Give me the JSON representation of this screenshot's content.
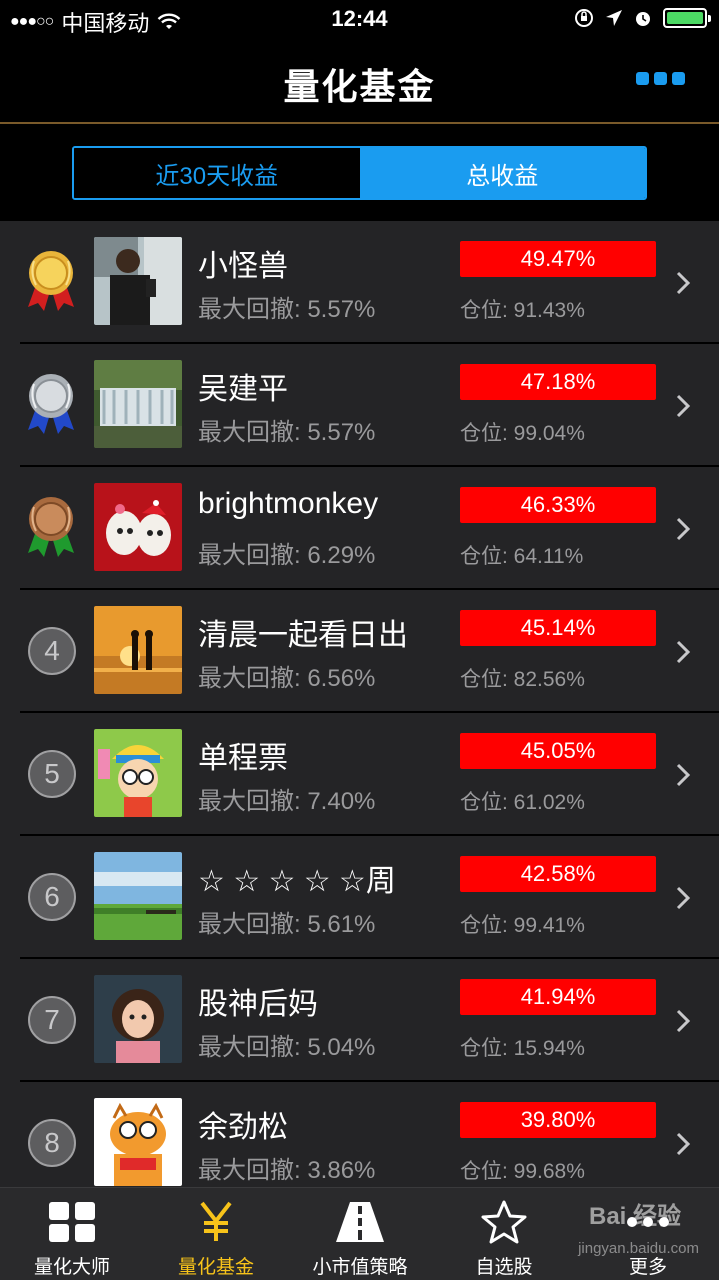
{
  "status_bar": {
    "carrier": "中国移动",
    "signal": "●●●○○",
    "time": "12:44"
  },
  "header": {
    "title": "量化基金"
  },
  "segment": {
    "tab_30d": "近30天收益",
    "tab_total": "总收益",
    "active": "总收益"
  },
  "colors": {
    "accent": "#1a9cf0",
    "return_bg": "#ff0000",
    "tab_active": "#f7c31a",
    "list_bg": "#242426"
  },
  "rows": [
    {
      "rank": "1",
      "badge": "gold-medal",
      "name": "小怪兽",
      "drawdown": "最大回撤: 5.57%",
      "return": "49.47%",
      "position": "仓位: 91.43%",
      "avatar": "person-selfie"
    },
    {
      "rank": "2",
      "badge": "silver-medal",
      "name": "吴建平",
      "drawdown": "最大回撤: 5.57%",
      "return": "47.18%",
      "position": "仓位: 99.04%",
      "avatar": "waterfall"
    },
    {
      "rank": "3",
      "badge": "bronze-medal",
      "name": "brightmonkey",
      "drawdown": "最大回撤: 6.29%",
      "return": "46.33%",
      "position": "仓位: 64.11%",
      "avatar": "eggs-couple"
    },
    {
      "rank": "4",
      "badge": "number",
      "name": "清晨一起看日出",
      "drawdown": "最大回撤: 6.56%",
      "return": "45.14%",
      "position": "仓位: 82.56%",
      "avatar": "sunset-couple"
    },
    {
      "rank": "5",
      "badge": "number",
      "name": "单程票",
      "drawdown": "最大回撤: 7.40%",
      "return": "45.05%",
      "position": "仓位: 61.02%",
      "avatar": "cartoon-arale"
    },
    {
      "rank": "6",
      "badge": "number",
      "name": "☆ ☆ ☆ ☆ ☆周",
      "drawdown": "最大回撤: 5.61%",
      "return": "42.58%",
      "position": "仓位: 99.41%",
      "avatar": "grassland"
    },
    {
      "rank": "7",
      "badge": "number",
      "name": "股神后妈",
      "drawdown": "最大回撤: 5.04%",
      "return": "41.94%",
      "position": "仓位: 15.94%",
      "avatar": "little-girl"
    },
    {
      "rank": "8",
      "badge": "number",
      "name": "余劲松",
      "drawdown": "最大回撤: 3.86%",
      "return": "39.80%",
      "position": "仓位: 99.68%",
      "avatar": "garfield"
    }
  ],
  "tabbar": {
    "items": [
      {
        "label": "量化大师",
        "icon": "grid-icon"
      },
      {
        "label": "量化基金",
        "icon": "yen-icon"
      },
      {
        "label": "小市值策略",
        "icon": "road-icon"
      },
      {
        "label": "自选股",
        "icon": "star-icon"
      },
      {
        "label": "更多",
        "icon": "more-icon"
      }
    ],
    "active_index": 1
  },
  "watermark": {
    "text": "Bai 经验",
    "sub": "jingyan.baidu.com"
  }
}
